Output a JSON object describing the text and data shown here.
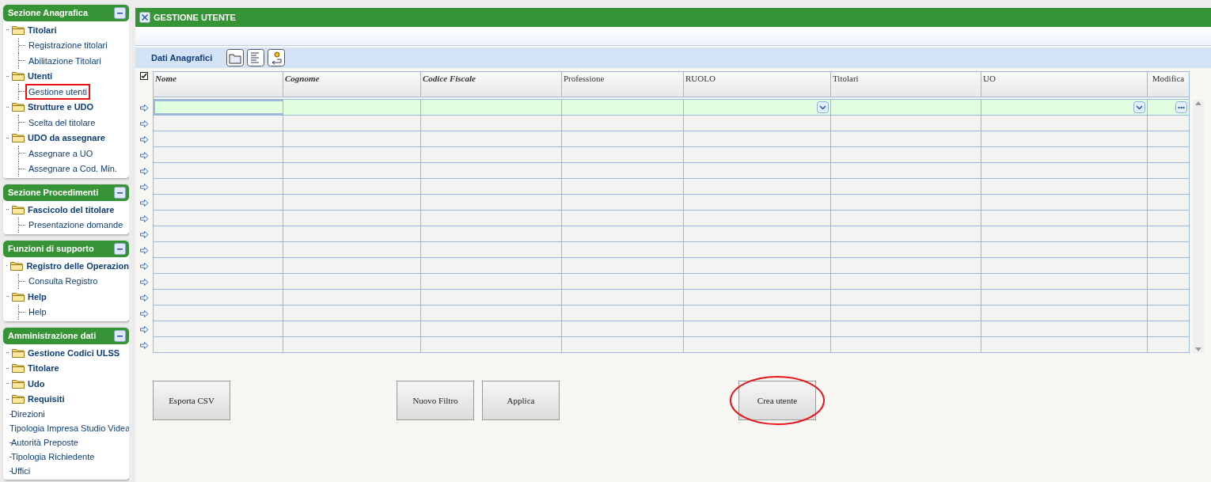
{
  "sidebar": {
    "panels": [
      {
        "title": "Sezione Anagrafica",
        "items": [
          {
            "kind": "folder",
            "label": "Titolari",
            "selected": false,
            "children": [
              {
                "kind": "leaf",
                "label": "Registrazione titolari",
                "selected": false
              },
              {
                "kind": "leaf",
                "label": "Abilitazione Titolari",
                "selected": false
              }
            ]
          },
          {
            "kind": "folder",
            "label": "Utenti",
            "selected": false,
            "children": [
              {
                "kind": "leaf",
                "label": "Gestione utenti",
                "selected": true
              }
            ]
          },
          {
            "kind": "folder",
            "label": "Strutture e UDO",
            "selected": false,
            "children": [
              {
                "kind": "leaf",
                "label": "Scelta del titolare",
                "selected": false
              }
            ]
          },
          {
            "kind": "folder",
            "label": "UDO da assegnare",
            "selected": false,
            "children": [
              {
                "kind": "leaf",
                "label": "Assegnare a UO",
                "selected": false
              },
              {
                "kind": "leaf",
                "label": "Assegnare a Cod. Min.",
                "selected": false
              }
            ]
          }
        ]
      },
      {
        "title": "Sezione Procedimenti",
        "items": [
          {
            "kind": "folder",
            "label": "Fascicolo del titolare",
            "selected": false,
            "children": [
              {
                "kind": "leaf",
                "label": "Presentazione domande",
                "selected": false
              }
            ]
          }
        ]
      },
      {
        "title": "Funzioni di supporto",
        "items": [
          {
            "kind": "folder",
            "label": "Registro delle Operazion",
            "selected": false,
            "children": [
              {
                "kind": "leaf",
                "label": "Consulta Registro",
                "selected": false
              }
            ]
          },
          {
            "kind": "folder",
            "label": "Help",
            "selected": false,
            "children": [
              {
                "kind": "leaf",
                "label": "Help",
                "selected": false
              }
            ]
          }
        ]
      },
      {
        "title": "Amministrazione dati",
        "items": [
          {
            "kind": "folder",
            "label": "Gestione Codici ULSS",
            "selected": false
          },
          {
            "kind": "folder",
            "label": "Titolare",
            "selected": false
          },
          {
            "kind": "folder",
            "label": "Udo",
            "selected": false
          },
          {
            "kind": "folder",
            "label": "Requisiti",
            "selected": false
          },
          {
            "kind": "plain",
            "label": "Direzioni",
            "selected": false
          },
          {
            "kind": "plain",
            "label": "Tipologia Impresa Studio Videa",
            "selected": false
          },
          {
            "kind": "plain",
            "label": "Autorità Preposte",
            "selected": false
          },
          {
            "kind": "plain",
            "label": "Tipologia Richiedente",
            "selected": false
          },
          {
            "kind": "plain",
            "label": "Uffici",
            "selected": false
          }
        ]
      }
    ]
  },
  "window": {
    "title": "GESTIONE UTENTE"
  },
  "section": {
    "title": "Dati Anagrafici"
  },
  "table": {
    "select_all": {
      "checked": true
    },
    "columns": [
      {
        "label": "Nome",
        "emphasized": true
      },
      {
        "label": "Cognome",
        "emphasized": true
      },
      {
        "label": "Codice Fiscale",
        "emphasized": true
      },
      {
        "label": "Professione",
        "emphasized": false
      },
      {
        "label": "RUOLO",
        "emphasized": false,
        "filter": {
          "kind": "dropdown"
        }
      },
      {
        "label": "Titolari",
        "emphasized": false
      },
      {
        "label": "UO",
        "emphasized": false,
        "filter": {
          "kind": "dropdown"
        }
      },
      {
        "label": "Modifica",
        "emphasized": false,
        "filter": {
          "kind": "ellipsis"
        }
      }
    ],
    "rows": [
      {
        "kind": "filter"
      },
      {
        "kind": "empty"
      },
      {
        "kind": "empty"
      },
      {
        "kind": "empty"
      },
      {
        "kind": "empty"
      },
      {
        "kind": "empty"
      },
      {
        "kind": "empty"
      },
      {
        "kind": "empty"
      },
      {
        "kind": "empty"
      },
      {
        "kind": "empty"
      },
      {
        "kind": "empty"
      },
      {
        "kind": "empty"
      },
      {
        "kind": "empty"
      },
      {
        "kind": "empty"
      },
      {
        "kind": "empty"
      },
      {
        "kind": "empty"
      }
    ]
  },
  "buttons": [
    {
      "label": "Esporta CSV",
      "circled": false
    },
    {
      "label": "Nuovo Filtro",
      "circled": false
    },
    {
      "label": "Applica",
      "circled": false
    },
    {
      "label": "Crea utente",
      "circled": true
    }
  ]
}
